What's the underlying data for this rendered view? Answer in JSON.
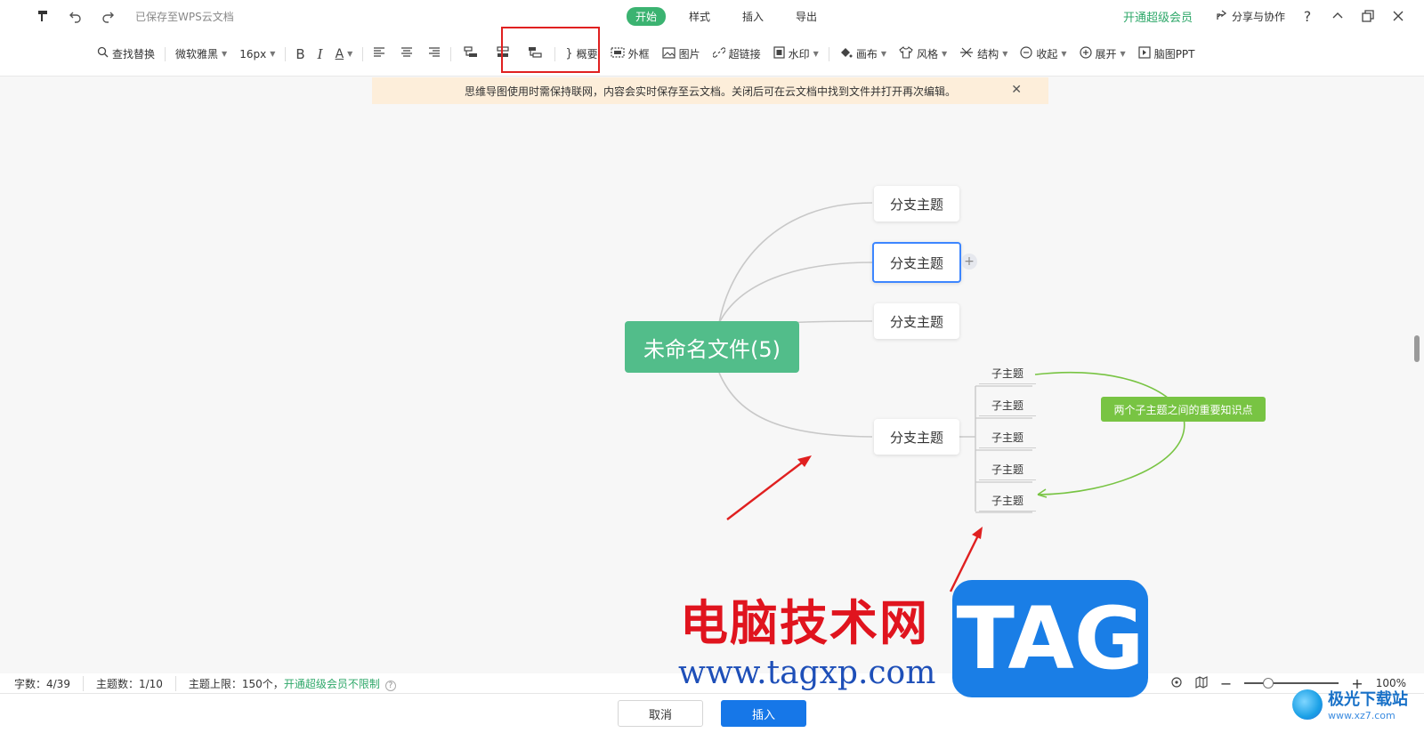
{
  "topbar": {
    "saved_status": "已保存至WPS云文档",
    "tabs": [
      {
        "label": "开始",
        "active": true
      },
      {
        "label": "样式",
        "active": false
      },
      {
        "label": "插入",
        "active": false
      },
      {
        "label": "导出",
        "active": false
      }
    ],
    "vip_label": "开通超级会员",
    "share_label": "分享与协作"
  },
  "toolbar": {
    "find_replace": "查找替换",
    "font": "微软雅黑",
    "font_size": "16px",
    "summary": "概要",
    "outer_frame": "外框",
    "image": "图片",
    "hyperlink": "超链接",
    "watermark": "水印",
    "canvas": "画布",
    "style": "风格",
    "structure": "结构",
    "collapse": "收起",
    "expand": "展开",
    "mindmap_ppt": "脑图PPT"
  },
  "notice": {
    "text": "思维导图使用时需保持联网，内容会实时保存至云文档。关闭后可在云文档中找到文件并打开再次编辑。"
  },
  "mindmap": {
    "root": "未命名文件(5)",
    "branches": [
      "分支主题",
      "分支主题",
      "分支主题",
      "分支主题"
    ],
    "subtopics": [
      "子主题",
      "子主题",
      "子主题",
      "子主题",
      "子主题"
    ],
    "relation_note": "两个子主题之间的重要知识点",
    "colors": {
      "root": "#52bd8a",
      "note": "#78c443",
      "selection": "#3d86ff"
    }
  },
  "watermark": {
    "site_name": "电脑技术网",
    "url": "www.tagxp.com",
    "tag": "TAG",
    "logo_text": "极光下载站",
    "logo_url": "www.xz7.com"
  },
  "status": {
    "word_count": "字数：4/39",
    "topic_count": "主题数：1/10",
    "topic_limit": "主题上限：150个，",
    "vip_unlimited": "开通超级会员不限制",
    "zoom": "100%"
  },
  "buttons": {
    "cancel": "取消",
    "insert": "插入"
  }
}
